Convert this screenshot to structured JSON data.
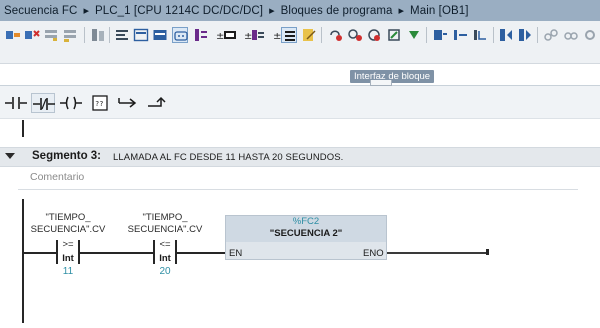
{
  "breadcrumb": {
    "items": [
      "Secuencia FC",
      "PLC_1 [CPU 1214C DC/DC/DC]",
      "Bloques de programa",
      "Main [OB1]"
    ],
    "separator": "▸"
  },
  "toolbar": {
    "icons": [
      "insert-network-icon",
      "delete-network-icon",
      "insert-row-icon",
      "append-row-icon",
      "compare-blocks-icon",
      "absolute-operands-icon",
      "network-view-icon",
      "open-all-networks-icon",
      "close-all-networks-icon",
      "comment-icon",
      "favorites-toggle-icon",
      "operand-display-icon",
      "symbol-info-icon",
      "tag-info-icon",
      "show-all-icon",
      "monitor-icon",
      "delete-comment-icon",
      "clear-comment-icon",
      "go-to-error-icon",
      "next-error-icon",
      "previous-error-icon",
      "download-icon",
      "upload-icon",
      "step-icon",
      "inputs-icon",
      "back-icon",
      "forward-icon",
      "watch-icon",
      "glasses-icon",
      "settings-icon"
    ],
    "interface_label": "Interfaz de bloque"
  },
  "favorites": {
    "items": [
      {
        "icon": "normally-open-contact-icon"
      },
      {
        "icon": "normally-closed-contact-icon"
      },
      {
        "icon": "output-coil-icon"
      },
      {
        "icon": "empty-box-icon"
      },
      {
        "icon": "open-branch-icon"
      },
      {
        "icon": "close-branch-icon"
      }
    ]
  },
  "segment": {
    "title": "Segmento 3:",
    "description": "LLAMADA AL FC DESDE 11 HASTA 20 SEGUNDOS.",
    "comment_placeholder": "Comentario"
  },
  "network": {
    "compare1": {
      "operand_line1": "\"TIEMPO_",
      "operand_line2": "SECUENCIA\".CV",
      "operator": ">=",
      "type": "Int",
      "value": "11"
    },
    "compare2": {
      "operand_line1": "\"TIEMPO_",
      "operand_line2": "SECUENCIA\".CV",
      "operator": "<=",
      "type": "Int",
      "value": "20"
    },
    "fc_call": {
      "instance": "%FC2",
      "name": "\"SECUENCIA 2\"",
      "en": "EN",
      "eno": "ENO"
    }
  },
  "colors": {
    "titlebar": "#9aaec2",
    "segment_header": "#e4e8ec",
    "operand_value": "#2f8fa5",
    "fc_block": "#dfe5eb"
  }
}
